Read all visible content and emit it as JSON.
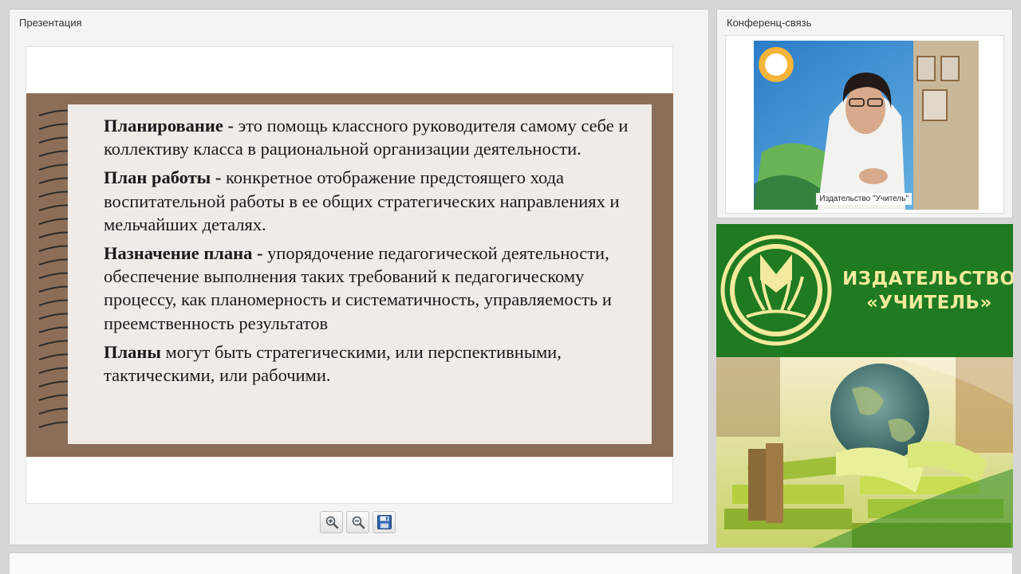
{
  "presentation": {
    "title": "Презентация",
    "slide": {
      "items": [
        {
          "term": "Планирование -",
          "text": " это помощь классного руководителя самому себе и коллективу класса в рациональной организации деятельности."
        },
        {
          "term": "План работы -",
          "text": " конкретное отображение предстоящего хода воспитательной работы в ее общих стратегических направлениях и мельчайших деталях."
        },
        {
          "term": "Назначение плана -",
          "text": " упорядочение педагогической деятельности, обеспечение выполнения таких требований к педагогическому процессу, как планомерность и систематичность, управляемость и преемственность результатов"
        },
        {
          "term": "Планы",
          "text": " могут быть стратегическими, или перспективными, тактическими, или рабочими."
        }
      ]
    },
    "toolbar": {
      "zoom_in_icon": "zoom-in-icon",
      "zoom_out_icon": "zoom-out-icon",
      "save_icon": "floppy-disk-icon"
    }
  },
  "conference": {
    "title": "Конференц-связь",
    "video_caption": "Издательство \"Учитель\""
  },
  "banner": {
    "line1": "ИЗДАТЕЛЬСТВО",
    "line2": "«УЧИТЕЛЬ»"
  },
  "colors": {
    "slide_frame": "#8c6e58",
    "slide_paper": "#efebe6",
    "banner_green": "#1f7a21",
    "brand_text": "#f3ea9e"
  }
}
